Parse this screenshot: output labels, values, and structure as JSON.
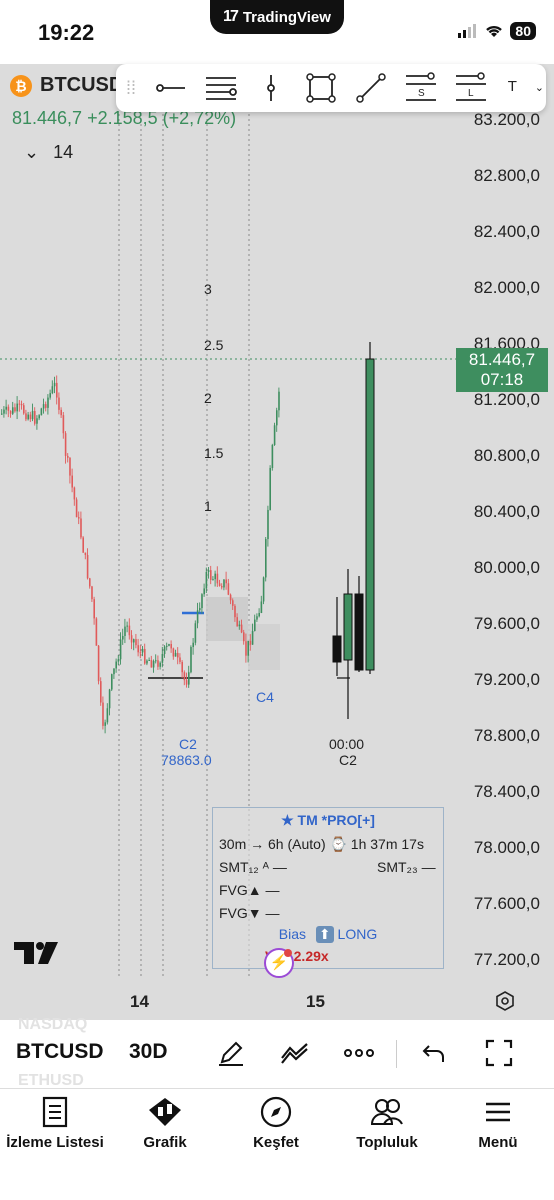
{
  "status": {
    "time": "19:22",
    "app_name": "TradingView",
    "battery": "80"
  },
  "symbol": {
    "name": "BTCUSD",
    "icon": "bitcoin-icon",
    "price_change": "81.446,7 +2.158,5 (+2,72%)",
    "collapsed_count": "14",
    "timeframe_visible": "T"
  },
  "toolbar": {
    "tools": [
      "horizontal-line-icon",
      "horizontal-lines-icon",
      "vertical-line-icon",
      "rectangle-icon",
      "trend-line-icon",
      "s-lines-icon",
      "l-lines-icon"
    ],
    "s_label": "S",
    "l_label": "L"
  },
  "price_axis": {
    "labels": [
      "83.200,0",
      "82.800,0",
      "82.400,0",
      "82.000,0",
      "81.600,0",
      "81.200,0",
      "80.800,0",
      "80.400,0",
      "80.000,0",
      "79.600,0",
      "79.200,0",
      "78.800,0",
      "78.400,0",
      "78.000,0",
      "77.600,0",
      "77.200,0"
    ],
    "last_price": "81.446,7",
    "countdown": "07:18"
  },
  "fib_levels": [
    "3",
    "2.5",
    "2",
    "1.5",
    "1"
  ],
  "labels": {
    "c2_left": "C2",
    "c2_price": "78863.0",
    "c4": "C4",
    "time_0000": "00:00",
    "c2_right": "C2"
  },
  "date_axis": {
    "labels": [
      "14",
      "15"
    ]
  },
  "panel": {
    "title": "TM *PRO[+]",
    "timeframe_row": "30m → 6h (Auto) ⌚ 1h 37m 17s",
    "smt12": "SMT₁₂ ᴬ —",
    "smt23": "SMT₂₃ —",
    "fvg_up": "FVG▲ —",
    "fvg_down": "FVG▼ —",
    "bias_label": "Bias",
    "bias_value": "LONG",
    "vol_label": "Vol",
    "vol_value": "2.29x"
  },
  "bottom_toolbar": {
    "symbol": "BTCUSD",
    "interval": "30D",
    "ghost_top": "NASDAQ",
    "ghost_bottom": "ETHUSD"
  },
  "tabs": [
    {
      "label": "İzleme Listesi",
      "icon": "watchlist-icon"
    },
    {
      "label": "Grafik",
      "icon": "chart-icon"
    },
    {
      "label": "Keşfet",
      "icon": "compass-icon"
    },
    {
      "label": "Topluluk",
      "icon": "community-icon"
    },
    {
      "label": "Menü",
      "icon": "menu-icon"
    }
  ],
  "colors": {
    "up": "#3e8e5f",
    "down": "#e05a5a",
    "accent": "#3265c9",
    "background": "#dcdcdc"
  }
}
